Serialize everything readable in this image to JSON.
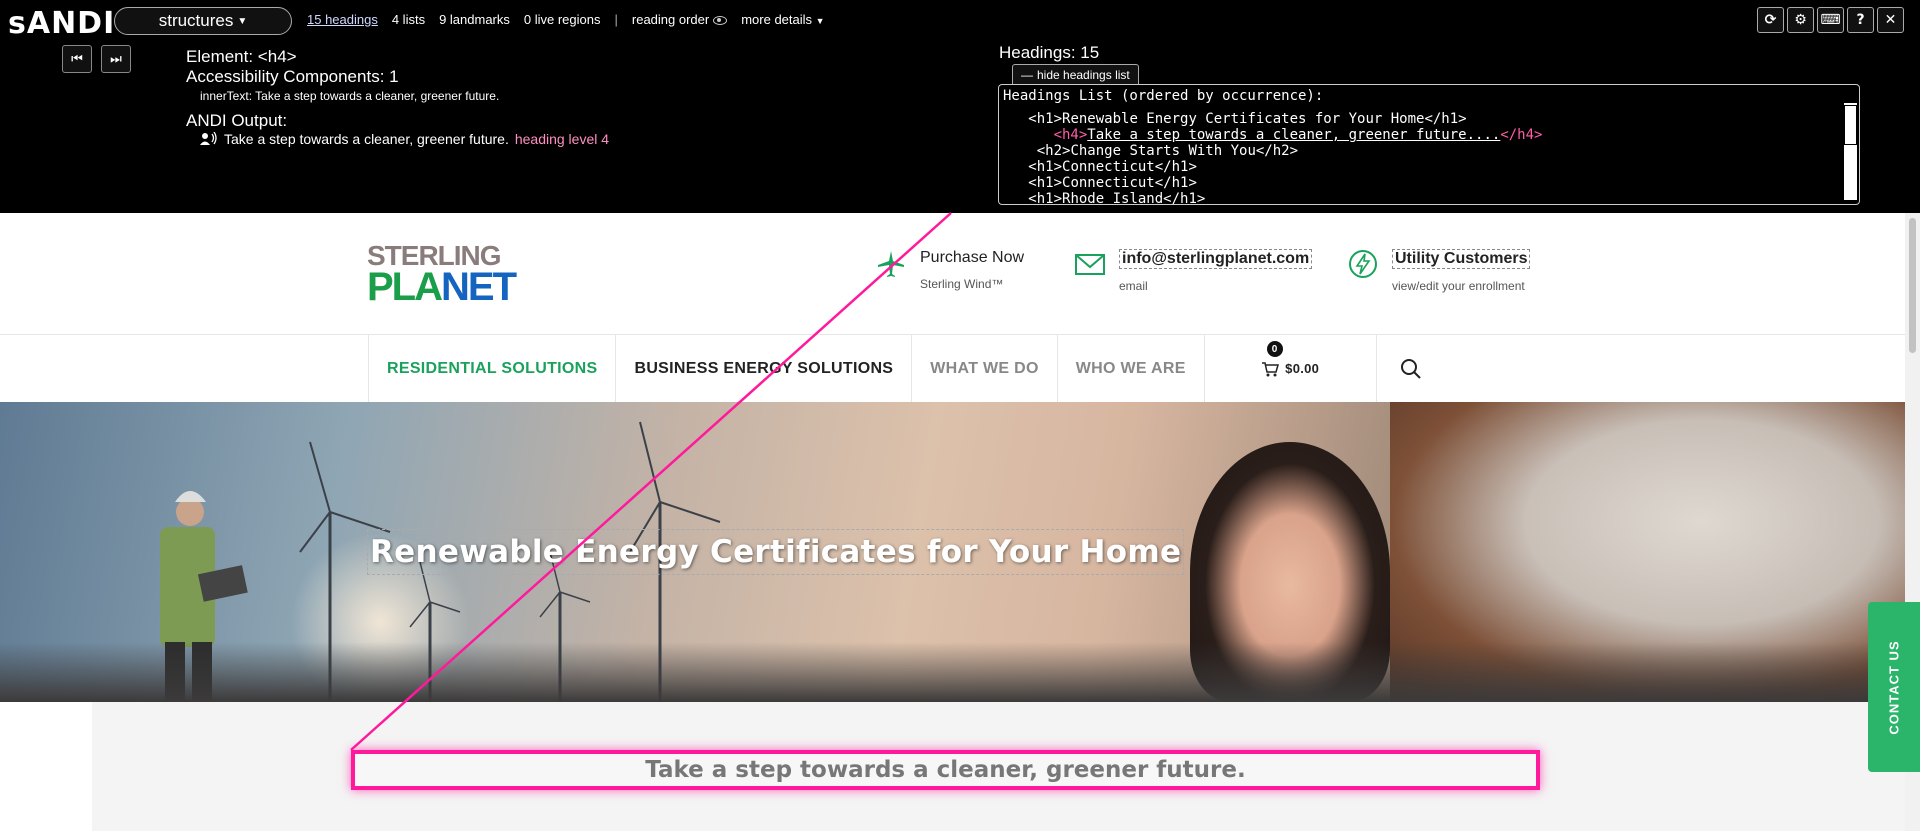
{
  "andi": {
    "logo": "sANDI",
    "module": "structures",
    "summary": {
      "headings": "15 headings",
      "lists": "4 lists",
      "landmarks": "9 landmarks",
      "live_regions": "0 live regions",
      "separator": "|",
      "reading_order": "reading order",
      "more_details": "more details"
    },
    "element": "Element: <h4>",
    "accessibility_components": "Accessibility Components: 1",
    "inner_text_label": "innerText:",
    "inner_text": "Take a step towards a cleaner, greener future.",
    "output_label": "ANDI Output:",
    "output_text": "Take a step towards a cleaner, greener future.",
    "output_level": "heading level 4",
    "headings_count": "Headings: 15",
    "hide_list_label": "hide headings list",
    "headings_list_title": "Headings List (ordered by occurrence):",
    "headings_list": [
      {
        "open": "<h1>",
        "text": "Renewable Energy Certificates for Your Home",
        "close": "</h1>",
        "indent": "   ",
        "active": false
      },
      {
        "open": "<h4>",
        "text": "Take a step towards a cleaner, greener future....",
        "close": "</h4>",
        "indent": "      ",
        "active": true
      },
      {
        "open": "<h2>",
        "text": "Change Starts With You",
        "close": "</h2>",
        "indent": "    ",
        "active": false
      },
      {
        "open": "<h1>",
        "text": "Connecticut",
        "close": "</h1>",
        "indent": "   ",
        "active": false
      },
      {
        "open": "<h1>",
        "text": "Connecticut",
        "close": "</h1>",
        "indent": "   ",
        "active": false
      },
      {
        "open": "<h1>",
        "text": "Rhode Island",
        "close": "</h1>",
        "indent": "   ",
        "active": false
      }
    ],
    "tools": [
      "refresh-icon",
      "gear-icon",
      "keyboard-icon",
      "help-icon",
      "close-icon"
    ],
    "tool_glyphs": [
      "⟳",
      "⚙",
      "⌨",
      "?",
      "✕"
    ],
    "highlight_color": "#ff1a9c"
  },
  "site": {
    "logo": {
      "line1": "STERLING",
      "line2_a": "PLA",
      "line2_b": "NET"
    },
    "contacts": {
      "purchase": {
        "main": "Purchase Now",
        "sub": "Sterling Wind™"
      },
      "email": {
        "main": "info@sterlingplanet.com",
        "sub": "email"
      },
      "utility": {
        "main": "Utility Customers",
        "sub": "view/edit your enrollment"
      }
    },
    "nav": {
      "residential": "RESIDENTIAL SOLUTIONS",
      "business": "BUSINESS ENERGY SOLUTIONS",
      "what_we_do": "WHAT WE DO",
      "who_we_are": "WHO WE ARE",
      "cart_count": "0",
      "cart_total": "$0.00"
    },
    "hero_title": "Renewable Energy Certificates for Your Home",
    "subheading": "Take a step towards a cleaner, greener future.",
    "contact_tab": "CONTACT US",
    "brand_green": "#1aa25c"
  }
}
